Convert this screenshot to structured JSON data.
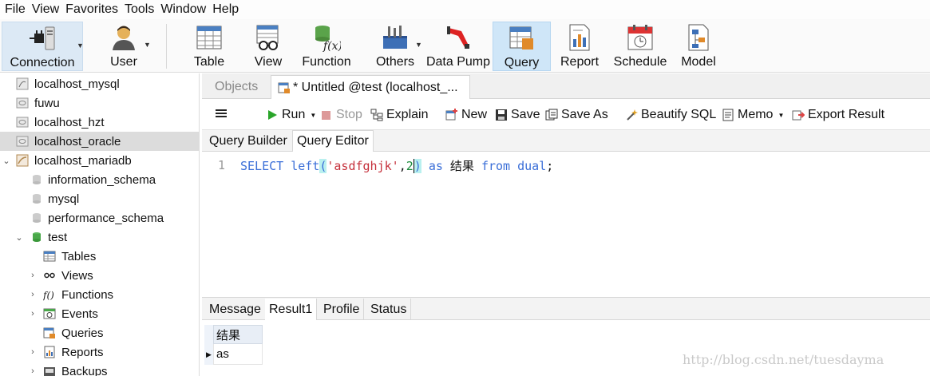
{
  "menu": [
    "File",
    "View",
    "Favorites",
    "Tools",
    "Window",
    "Help"
  ],
  "toolbar": {
    "connection": "Connection",
    "user": "User",
    "table": "Table",
    "view": "View",
    "function": "Function",
    "others": "Others",
    "data_pump": "Data Pump",
    "query": "Query",
    "report": "Report",
    "schedule": "Schedule",
    "model": "Model"
  },
  "tree": {
    "localhost_mysql": "localhost_mysql",
    "fuwu": "fuwu",
    "localhost_hzt": "localhost_hzt",
    "localhost_oracle": "localhost_oracle",
    "localhost_mariadb": "localhost_mariadb",
    "information_schema": "information_schema",
    "mysql": "mysql",
    "performance_schema": "performance_schema",
    "test": "test",
    "tables": "Tables",
    "views": "Views",
    "functions": "Functions",
    "events": "Events",
    "queries": "Queries",
    "reports": "Reports",
    "backups": "Backups"
  },
  "tabs": {
    "objects": "Objects",
    "untitled": "* Untitled @test (localhost_..."
  },
  "query_toolbar": {
    "run": "Run",
    "stop": "Stop",
    "explain": "Explain",
    "new": "New",
    "save": "Save",
    "save_as": "Save As",
    "beautify": "Beautify SQL",
    "memo": "Memo",
    "export": "Export Result"
  },
  "subtabs": {
    "builder": "Query Builder",
    "editor": "Query Editor"
  },
  "editor": {
    "line_number": "1",
    "kw_select": "SELECT",
    "fn_left": "left",
    "paren_open": "(",
    "str_value": "'asdfghjk'",
    "comma": ",",
    "num_value": "2",
    "paren_close": ")",
    "kw_as": "as",
    "alias": "结果",
    "kw_from": "from",
    "kw_dual": "dual",
    "semicolon": ";"
  },
  "result_tabs": {
    "message": "Message",
    "result1": "Result1",
    "profile": "Profile",
    "status": "Status"
  },
  "grid": {
    "column": "结果",
    "value": "as"
  },
  "watermark": "http://blog.csdn.net/tuesdayma",
  "colors": {
    "keyword": "#3b6fd8",
    "string": "#c5303b",
    "number": "#1a8a3a",
    "active_toolbar": "#cfe6f8",
    "selection": "#dcdcdc"
  }
}
